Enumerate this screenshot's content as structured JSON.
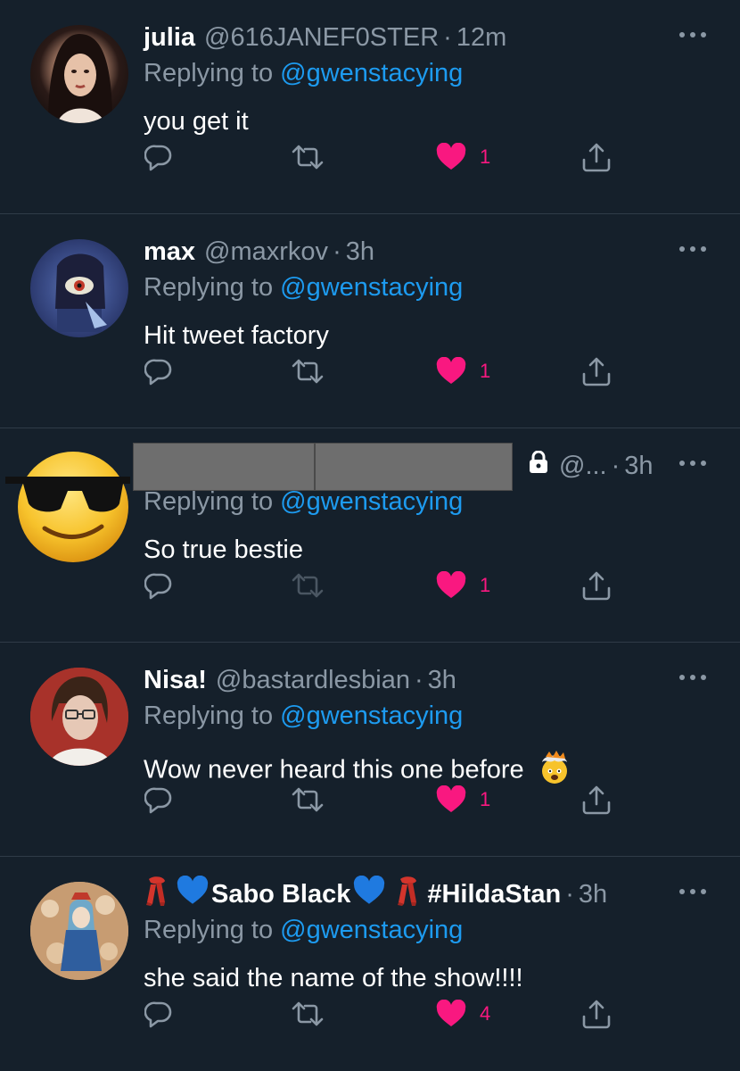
{
  "tweets": [
    {
      "name": "julia",
      "handle": "@616JANEF0STER",
      "time": "12m",
      "replying_prefix": "Replying to",
      "replying_to": "@gwenstacying",
      "text": "you get it",
      "likes": "1",
      "avatar": "portrait-woman"
    },
    {
      "name": "max",
      "handle": "@maxrkov",
      "time": "3h",
      "replying_prefix": "Replying to",
      "replying_to": "@gwenstacying",
      "text": "Hit tweet factory",
      "likes": "1",
      "avatar": "illustrated-hand-eye"
    },
    {
      "name": "",
      "handle": "@...",
      "time": "3h",
      "replying_prefix": "Replying to",
      "replying_to": "@gwenstacying",
      "text": "So true bestie",
      "likes": "1",
      "avatar": "sunglasses-emoji",
      "protected": true
    },
    {
      "name": "Nisa!",
      "handle": "@bastardlesbian",
      "time": "3h",
      "replying_prefix": "Replying to",
      "replying_to": "@gwenstacying",
      "text": "Wow never heard this one before",
      "text_emoji": "exploding-head-emoji",
      "likes": "1",
      "avatar": "portrait-glasses"
    },
    {
      "name": "Sabo Black",
      "name_suffix": "#HildaStan",
      "handle": "",
      "time": "3h",
      "replying_prefix": "Replying to",
      "replying_to": "@gwenstacying",
      "text": "she said the name of the show!!!!",
      "likes": "4",
      "avatar": "illustrated-group"
    }
  ],
  "colors": {
    "background": "#15202b",
    "muted": "#8b98a5",
    "link": "#1d9bf0",
    "like": "#f91880",
    "divider": "#2f3b47"
  }
}
